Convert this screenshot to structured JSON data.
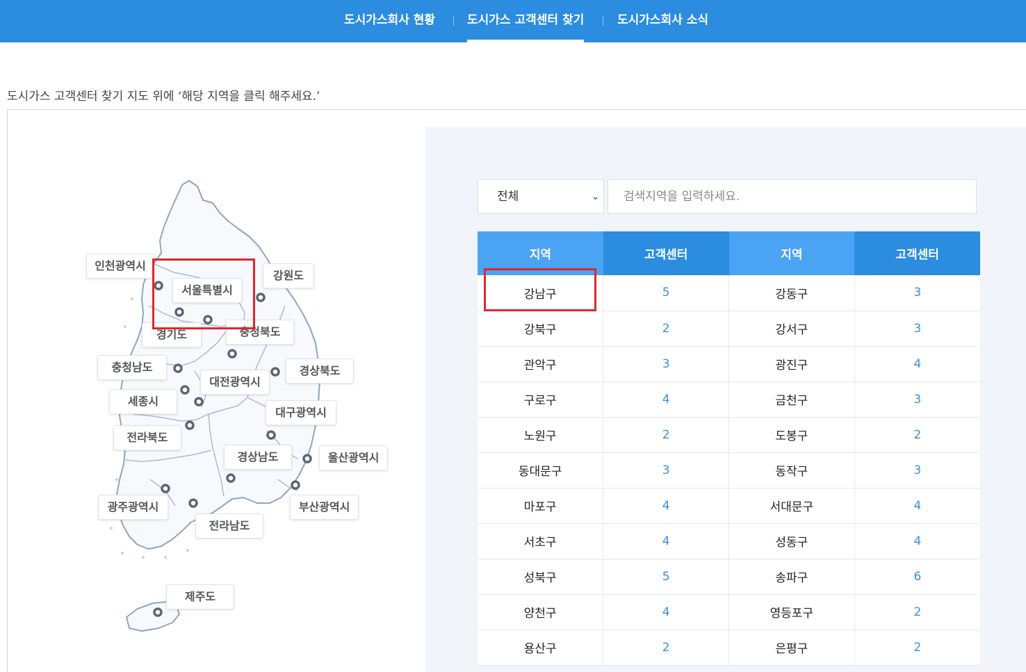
{
  "nav": {
    "tabs": [
      {
        "label": "도시가스회사 현황"
      },
      {
        "label": "도시가스 고객센터 찾기"
      },
      {
        "label": "도시가스회사 소식"
      }
    ]
  },
  "instruction": "도시가스 고객센터 찾기 지도 위에 ‘해당 지역을 클릭 해주세요.’",
  "map": {
    "regions": [
      {
        "label": "인천광역시"
      },
      {
        "label": "서울특별시"
      },
      {
        "label": "강원도"
      },
      {
        "label": "경기도"
      },
      {
        "label": "충청북도"
      },
      {
        "label": "충청남도"
      },
      {
        "label": "대전광역시"
      },
      {
        "label": "경상북도"
      },
      {
        "label": "세종시"
      },
      {
        "label": "대구광역시"
      },
      {
        "label": "전라북도"
      },
      {
        "label": "경상남도"
      },
      {
        "label": "울산광역시"
      },
      {
        "label": "광주광역시"
      },
      {
        "label": "부산광역시"
      },
      {
        "label": "전라남도"
      },
      {
        "label": "제주도"
      }
    ]
  },
  "filter": {
    "select_value": "전체",
    "search_placeholder": "검색지역을 입력하세요."
  },
  "table": {
    "headers": [
      "지역",
      "고객센터",
      "지역",
      "고객센터"
    ],
    "rows": [
      [
        "강남구",
        "5",
        "강동구",
        "3"
      ],
      [
        "강북구",
        "2",
        "강서구",
        "3"
      ],
      [
        "관악구",
        "3",
        "광진구",
        "4"
      ],
      [
        "구로구",
        "4",
        "금천구",
        "3"
      ],
      [
        "노원구",
        "2",
        "도봉구",
        "2"
      ],
      [
        "동대문구",
        "3",
        "동작구",
        "3"
      ],
      [
        "마포구",
        "4",
        "서대문구",
        "4"
      ],
      [
        "서초구",
        "4",
        "성동구",
        "4"
      ],
      [
        "성북구",
        "5",
        "송파구",
        "6"
      ],
      [
        "양천구",
        "4",
        "영등포구",
        "2"
      ],
      [
        "용산구",
        "2",
        "은평구",
        "2"
      ]
    ]
  },
  "colors": {
    "nav_bg": "#2b8ce0",
    "header_light": "#4aa3f3",
    "header_dark": "#2b8ce0",
    "count_text": "#3d8fd6",
    "highlight": "#e0262e",
    "panel_bg": "#f1f4f8"
  }
}
